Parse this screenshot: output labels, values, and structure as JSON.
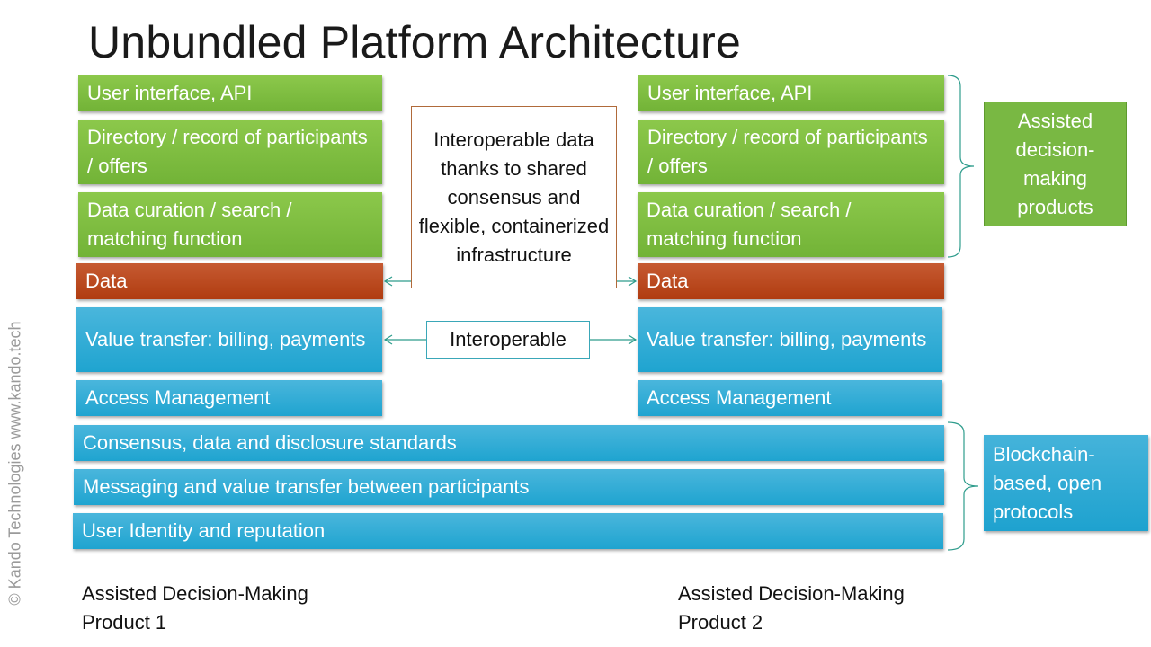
{
  "title": "Unbundled Platform Architecture",
  "watermark": "© Kando Technologies www.kando.tech",
  "product1": {
    "layers": [
      {
        "label": "User interface, API",
        "color": "green"
      },
      {
        "label": "Directory / record of participants / offers",
        "color": "green"
      },
      {
        "label": "Data curation / search / matching function",
        "color": "green"
      },
      {
        "label": "Data",
        "color": "red"
      },
      {
        "label": "Value transfer: billing, payments",
        "color": "blue"
      },
      {
        "label": "Access Management",
        "color": "blue"
      }
    ],
    "caption": "Assisted Decision-Making Product 1"
  },
  "product2": {
    "layers": [
      {
        "label": "User interface, API",
        "color": "green"
      },
      {
        "label": "Directory / record of participants / offers",
        "color": "green"
      },
      {
        "label": "Data curation / search / matching function",
        "color": "green"
      },
      {
        "label": "Data",
        "color": "red"
      },
      {
        "label": "Value transfer: billing, payments",
        "color": "blue"
      },
      {
        "label": "Access Management",
        "color": "blue"
      }
    ],
    "caption": "Assisted Decision-Making Product 2"
  },
  "shared_layers": [
    "Consensus, data and disclosure standards",
    "Messaging and value transfer between participants",
    "User Identity and reputation"
  ],
  "callouts": {
    "data_interop": "Interoperable data thanks to shared consensus and flexible, containerized infrastructure",
    "value_interop": "Interoperable"
  },
  "side_labels": {
    "top": "Assisted decision-making products",
    "bottom": "Blockchain-based, open protocols"
  },
  "colors": {
    "green": "#7cbb42",
    "red": "#b94418",
    "blue": "#29abd6",
    "connector": "#2e9c8c"
  }
}
